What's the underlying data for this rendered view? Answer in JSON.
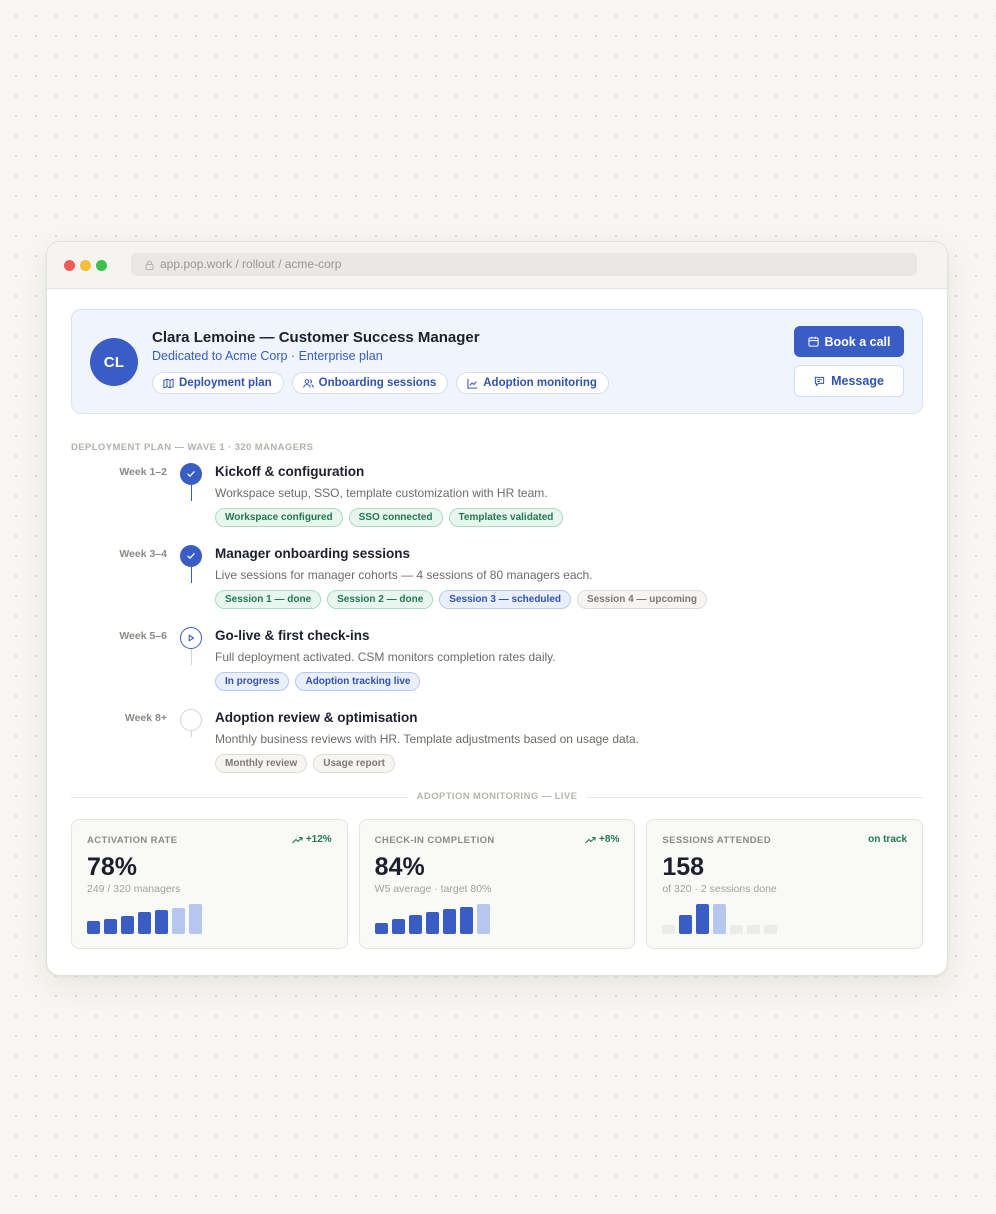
{
  "browser": {
    "url": "app.pop.work / rollout / acme-corp"
  },
  "csm": {
    "initials": "CL",
    "name": "Clara Lemoine — Customer Success Manager",
    "subtitle": "Dedicated to Acme Corp · Enterprise plan",
    "links": [
      {
        "label": "Deployment plan",
        "icon": "map-icon"
      },
      {
        "label": "Onboarding sessions",
        "icon": "users-icon"
      },
      {
        "label": "Adoption monitoring",
        "icon": "chart-line-icon"
      }
    ],
    "book_label": "Book a call",
    "message_label": "Message"
  },
  "plan": {
    "section_label": "DEPLOYMENT PLAN — WAVE 1 · 320 MANAGERS",
    "steps": [
      {
        "week": "Week 1–2",
        "status": "done",
        "title": "Kickoff & configuration",
        "desc": "Workspace setup, SSO, template customization with HR team.",
        "tags": [
          {
            "label": "Workspace configured",
            "tone": "green"
          },
          {
            "label": "SSO connected",
            "tone": "green"
          },
          {
            "label": "Templates validated",
            "tone": "green"
          }
        ]
      },
      {
        "week": "Week 3–4",
        "status": "done",
        "title": "Manager onboarding sessions",
        "desc": "Live sessions for manager cohorts — 4 sessions of 80 managers each.",
        "tags": [
          {
            "label": "Session 1 — done",
            "tone": "green"
          },
          {
            "label": "Session 2 — done",
            "tone": "green"
          },
          {
            "label": "Session 3 — scheduled",
            "tone": "blue"
          },
          {
            "label": "Session 4 — upcoming",
            "tone": "grey"
          }
        ]
      },
      {
        "week": "Week 5–6",
        "status": "active",
        "title": "Go-live & first check-ins",
        "desc": "Full deployment activated. CSM monitors completion rates daily.",
        "tags": [
          {
            "label": "In progress",
            "tone": "blue"
          },
          {
            "label": "Adoption tracking live",
            "tone": "blue"
          }
        ]
      },
      {
        "week": "Week 8+",
        "status": "todo",
        "title": "Adoption review & optimisation",
        "desc": "Monthly business reviews with HR. Template adjustments based on usage data.",
        "tags": [
          {
            "label": "Monthly review",
            "tone": "grey"
          },
          {
            "label": "Usage report",
            "tone": "grey"
          }
        ]
      }
    ]
  },
  "monitoring": {
    "divider_label": "ADOPTION MONITORING — LIVE",
    "metrics": [
      {
        "label": "ACTIVATION RATE",
        "delta": "+12%",
        "delta_icon": "trend-up-icon",
        "value": "78%",
        "sub": "249 / 320 managers",
        "bars": [
          0.42,
          0.5,
          0.6,
          0.72,
          0.8,
          0.88,
          1.0
        ],
        "bar_states": [
          "solid",
          "solid",
          "solid",
          "solid",
          "solid",
          "light",
          "light"
        ]
      },
      {
        "label": "CHECK-IN COMPLETION",
        "delta": "+8%",
        "delta_icon": "trend-up-icon",
        "value": "84%",
        "sub": "W5 average · target 80%",
        "bars": [
          0.35,
          0.5,
          0.62,
          0.72,
          0.82,
          0.9,
          1.0
        ],
        "bar_states": [
          "solid",
          "solid",
          "solid",
          "solid",
          "solid",
          "solid",
          "light"
        ]
      },
      {
        "label": "SESSIONS ATTENDED",
        "delta": "on track",
        "delta_icon": "",
        "value": "158",
        "sub": "of 320 · 2 sessions done",
        "bars": [
          0.3,
          0.62,
          1.0,
          1.0,
          0.3,
          0.3,
          0.3
        ],
        "bar_states": [
          "empty",
          "solid",
          "solid",
          "light",
          "empty",
          "empty",
          "empty"
        ]
      }
    ]
  },
  "colors": {
    "accent": "#3a5cc5",
    "accent_light": "#b5c6ef",
    "empty_bar": "#ecebe8",
    "positive": "#1e7a4f"
  }
}
